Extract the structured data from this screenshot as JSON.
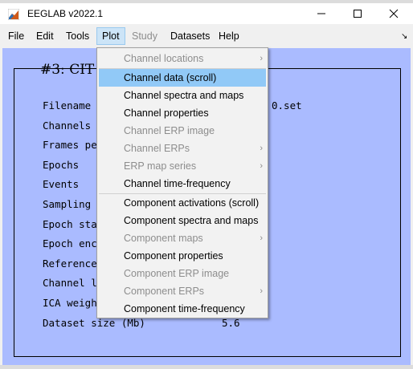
{
  "window": {
    "title": "EEGLAB v2022.1",
    "controls": [
      "minimize",
      "maximize",
      "close"
    ]
  },
  "menubar": {
    "items": [
      "File",
      "Edit",
      "Tools",
      "Plot",
      "Study",
      "Datasets",
      "Help"
    ],
    "active": "Plot",
    "disabled": [
      "Study"
    ]
  },
  "dataset": {
    "title": "#3: CIT",
    "rows": [
      {
        "label": "Filename",
        "value": "0.set"
      },
      {
        "label": "Channels",
        "value": ""
      },
      {
        "label": "Frames pe",
        "value": ""
      },
      {
        "label": "Epochs",
        "value": ""
      },
      {
        "label": "Events",
        "value": ""
      },
      {
        "label": "Sampling",
        "value": ""
      },
      {
        "label": "Epoch sta",
        "value": ""
      },
      {
        "label": "Epoch enc",
        "value": ""
      },
      {
        "label": "Reference",
        "value": ""
      },
      {
        "label": "Channel l",
        "value": ""
      },
      {
        "label": "ICA weigh",
        "value": ""
      },
      {
        "label": "Dataset size (Mb)",
        "value": "5.6"
      }
    ]
  },
  "plot_menu": {
    "items": [
      {
        "label": "Channel locations",
        "disabled": true,
        "submenu": true
      },
      {
        "label": "Channel data (scroll)",
        "disabled": false,
        "highlighted": true
      },
      {
        "label": "Channel spectra and maps",
        "disabled": false
      },
      {
        "label": "Channel properties",
        "disabled": false
      },
      {
        "label": "Channel ERP image",
        "disabled": true
      },
      {
        "label": "Channel ERPs",
        "disabled": true,
        "submenu": true
      },
      {
        "label": "ERP map series",
        "disabled": true,
        "submenu": true
      },
      {
        "label": "Channel time-frequency",
        "disabled": false
      },
      {
        "label": "Component activations (scroll)",
        "disabled": false
      },
      {
        "label": "Component spectra and maps",
        "disabled": false
      },
      {
        "label": "Component maps",
        "disabled": true,
        "submenu": true
      },
      {
        "label": "Component properties",
        "disabled": false
      },
      {
        "label": "Component ERP image",
        "disabled": true
      },
      {
        "label": "Component ERPs",
        "disabled": true,
        "submenu": true
      },
      {
        "label": "Component time-frequency",
        "disabled": false
      }
    ],
    "submenu_glyph": "›"
  },
  "colors": {
    "panel_bg": "#aabbff",
    "menu_highlight": "#91c9f7",
    "menubar_active": "#cce4f7",
    "disabled_text": "#8d8d8d"
  }
}
